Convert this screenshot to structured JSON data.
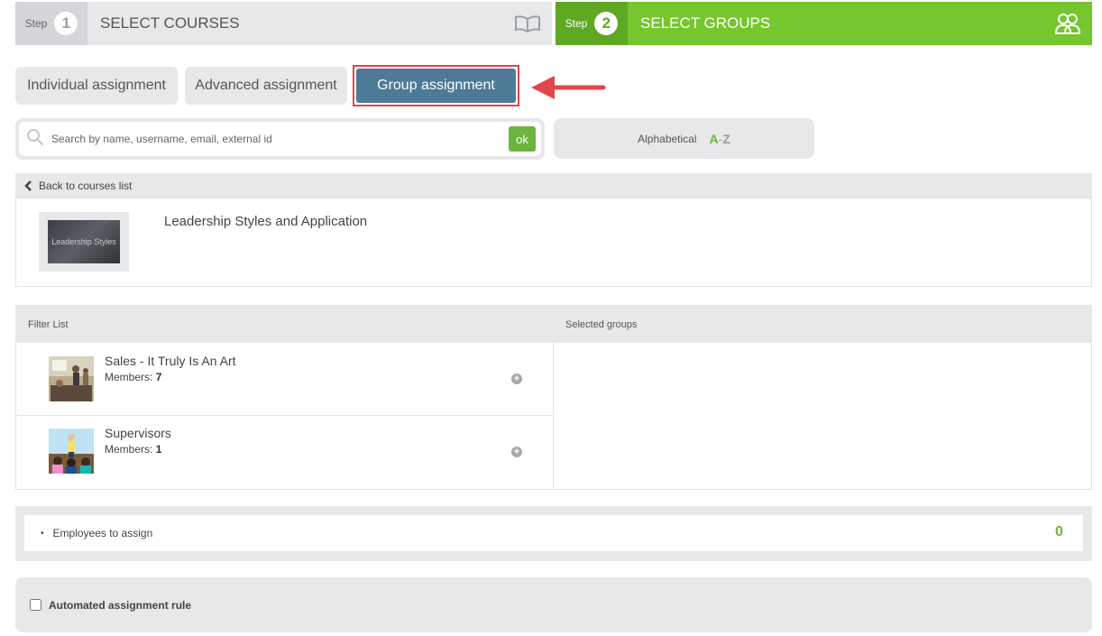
{
  "steps": [
    {
      "label": "Step",
      "number": "1",
      "title": "SELECT COURSES",
      "icon": "book-icon"
    },
    {
      "label": "Step",
      "number": "2",
      "title": "SELECT GROUPS",
      "icon": "users-icon"
    }
  ],
  "tabs": {
    "individual": "Individual assignment",
    "advanced": "Advanced assignment",
    "group": "Group assignment",
    "active": "group"
  },
  "search": {
    "placeholder": "Search by name, username, email, external id",
    "value": "",
    "ok_label": "ok"
  },
  "sort": {
    "label": "Alphabetical",
    "az_a": "A",
    "az_dash": "-",
    "az_z": "Z"
  },
  "course": {
    "back_label": "Back to courses list",
    "title": "Leadership Styles and Application",
    "thumb_text": "Leadership Styles"
  },
  "groups": {
    "filter_header": "Filter List",
    "selected_header": "Selected groups",
    "members_label": "Members:",
    "items": [
      {
        "name": "Sales - It Truly Is An Art",
        "members": "7"
      },
      {
        "name": "Supervisors",
        "members": "1"
      }
    ]
  },
  "employees": {
    "label": "Employees to assign",
    "count": "0"
  },
  "rule": {
    "label": "Automated assignment rule",
    "checked": false
  },
  "colors": {
    "step_active": "#76c630",
    "tab_active": "#4d7a96",
    "highlight": "#e0474a",
    "accent_green": "#6db33f"
  }
}
